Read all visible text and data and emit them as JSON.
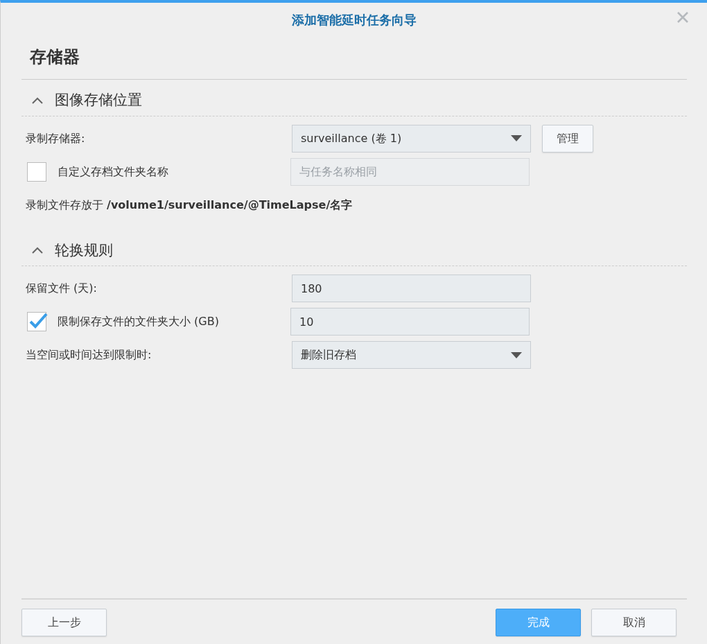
{
  "window": {
    "title": "添加智能延时任务向导"
  },
  "page_title": "存储器",
  "sections": [
    {
      "title": "图像存储位置",
      "expanded": true,
      "rows": [
        {
          "kind": "select",
          "label": "录制存储器:",
          "value": "surveillance (卷 1)",
          "button": "管理"
        },
        {
          "kind": "checkbox-input",
          "label": "自定义存档文件夹名称",
          "checked": false,
          "disabled": true,
          "placeholder": "与任务名称相同"
        },
        {
          "kind": "note",
          "text": "录制文件存放于 **/volume1/surveillance/@TimeLapse/名字**"
        }
      ]
    },
    {
      "title": "轮换规则",
      "expanded": true,
      "rows": [
        {
          "kind": "input",
          "label": "保留文件 (天):",
          "value": "180"
        },
        {
          "kind": "checkbox-input",
          "label": "限制保存文件的文件夹大小 (GB)",
          "checked": true,
          "disabled": false,
          "value": "10"
        },
        {
          "kind": "select",
          "label": "当空间或时间达到限制时:",
          "value": "删除旧存档"
        }
      ]
    }
  ],
  "footer": {
    "back": "上一步",
    "finish": "完成",
    "cancel": "取消"
  }
}
